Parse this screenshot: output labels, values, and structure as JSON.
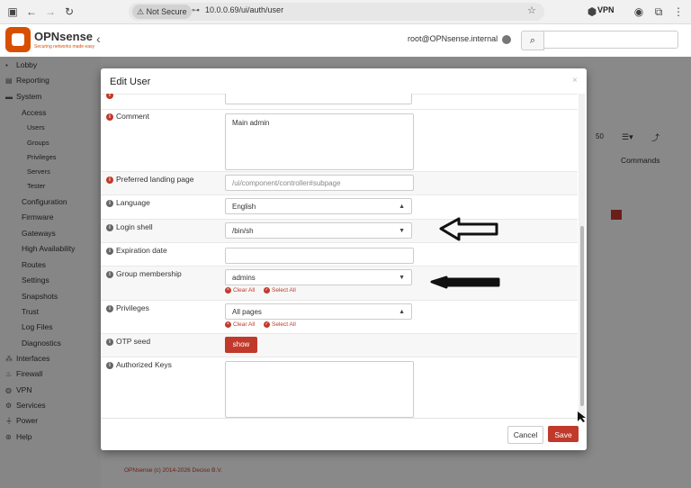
{
  "browser": {
    "security_badge": "Not Secure",
    "url": "10.0.0.69/ui/auth/user",
    "vpn_label": "VPN"
  },
  "header": {
    "logo_text": "OPNsense",
    "logo_tagline": "Securing networks made easy",
    "user": "root@OPNsense.internal"
  },
  "sidebar": {
    "items": [
      {
        "label": "Lobby"
      },
      {
        "label": "Reporting"
      },
      {
        "label": "System"
      },
      {
        "label": "Access"
      },
      {
        "label": "Users"
      },
      {
        "label": "Groups"
      },
      {
        "label": "Privileges"
      },
      {
        "label": "Servers"
      },
      {
        "label": "Tester"
      },
      {
        "label": "Configuration"
      },
      {
        "label": "Firmware"
      },
      {
        "label": "Gateways"
      },
      {
        "label": "High Availability"
      },
      {
        "label": "Routes"
      },
      {
        "label": "Settings"
      },
      {
        "label": "Snapshots"
      },
      {
        "label": "Trust"
      },
      {
        "label": "Log Files"
      },
      {
        "label": "Diagnostics"
      },
      {
        "label": "Interfaces"
      },
      {
        "label": "Firewall"
      },
      {
        "label": "VPN"
      },
      {
        "label": "Services"
      },
      {
        "label": "Power"
      },
      {
        "label": "Help"
      }
    ]
  },
  "background": {
    "page_size": "50",
    "commands_header": "Commands",
    "footer": "OPNsense (c) 2014-2026 Deciso B.V."
  },
  "modal": {
    "title": "Edit User",
    "close": "×",
    "fields": {
      "comment": {
        "label": "Comment",
        "value": "Main admin"
      },
      "landing": {
        "label": "Preferred landing page",
        "placeholder": "/ui/component/controller#subpage"
      },
      "language": {
        "label": "Language",
        "value": "English"
      },
      "shell": {
        "label": "Login shell",
        "value": "/bin/sh"
      },
      "expiration": {
        "label": "Expiration date",
        "value": ""
      },
      "groups": {
        "label": "Group membership",
        "value": "admins",
        "clear_all": "Clear All",
        "select_all": "Select All"
      },
      "privileges": {
        "label": "Privileges",
        "value": "All pages",
        "clear_all": "Clear All",
        "select_all": "Select All"
      },
      "otp": {
        "label": "OTP seed",
        "button": "show"
      },
      "keys": {
        "label": "Authorized Keys",
        "value": ""
      }
    },
    "buttons": {
      "cancel": "Cancel",
      "save": "Save"
    }
  },
  "colors": {
    "brand": "#d94f00",
    "accent": "#c0392b"
  }
}
